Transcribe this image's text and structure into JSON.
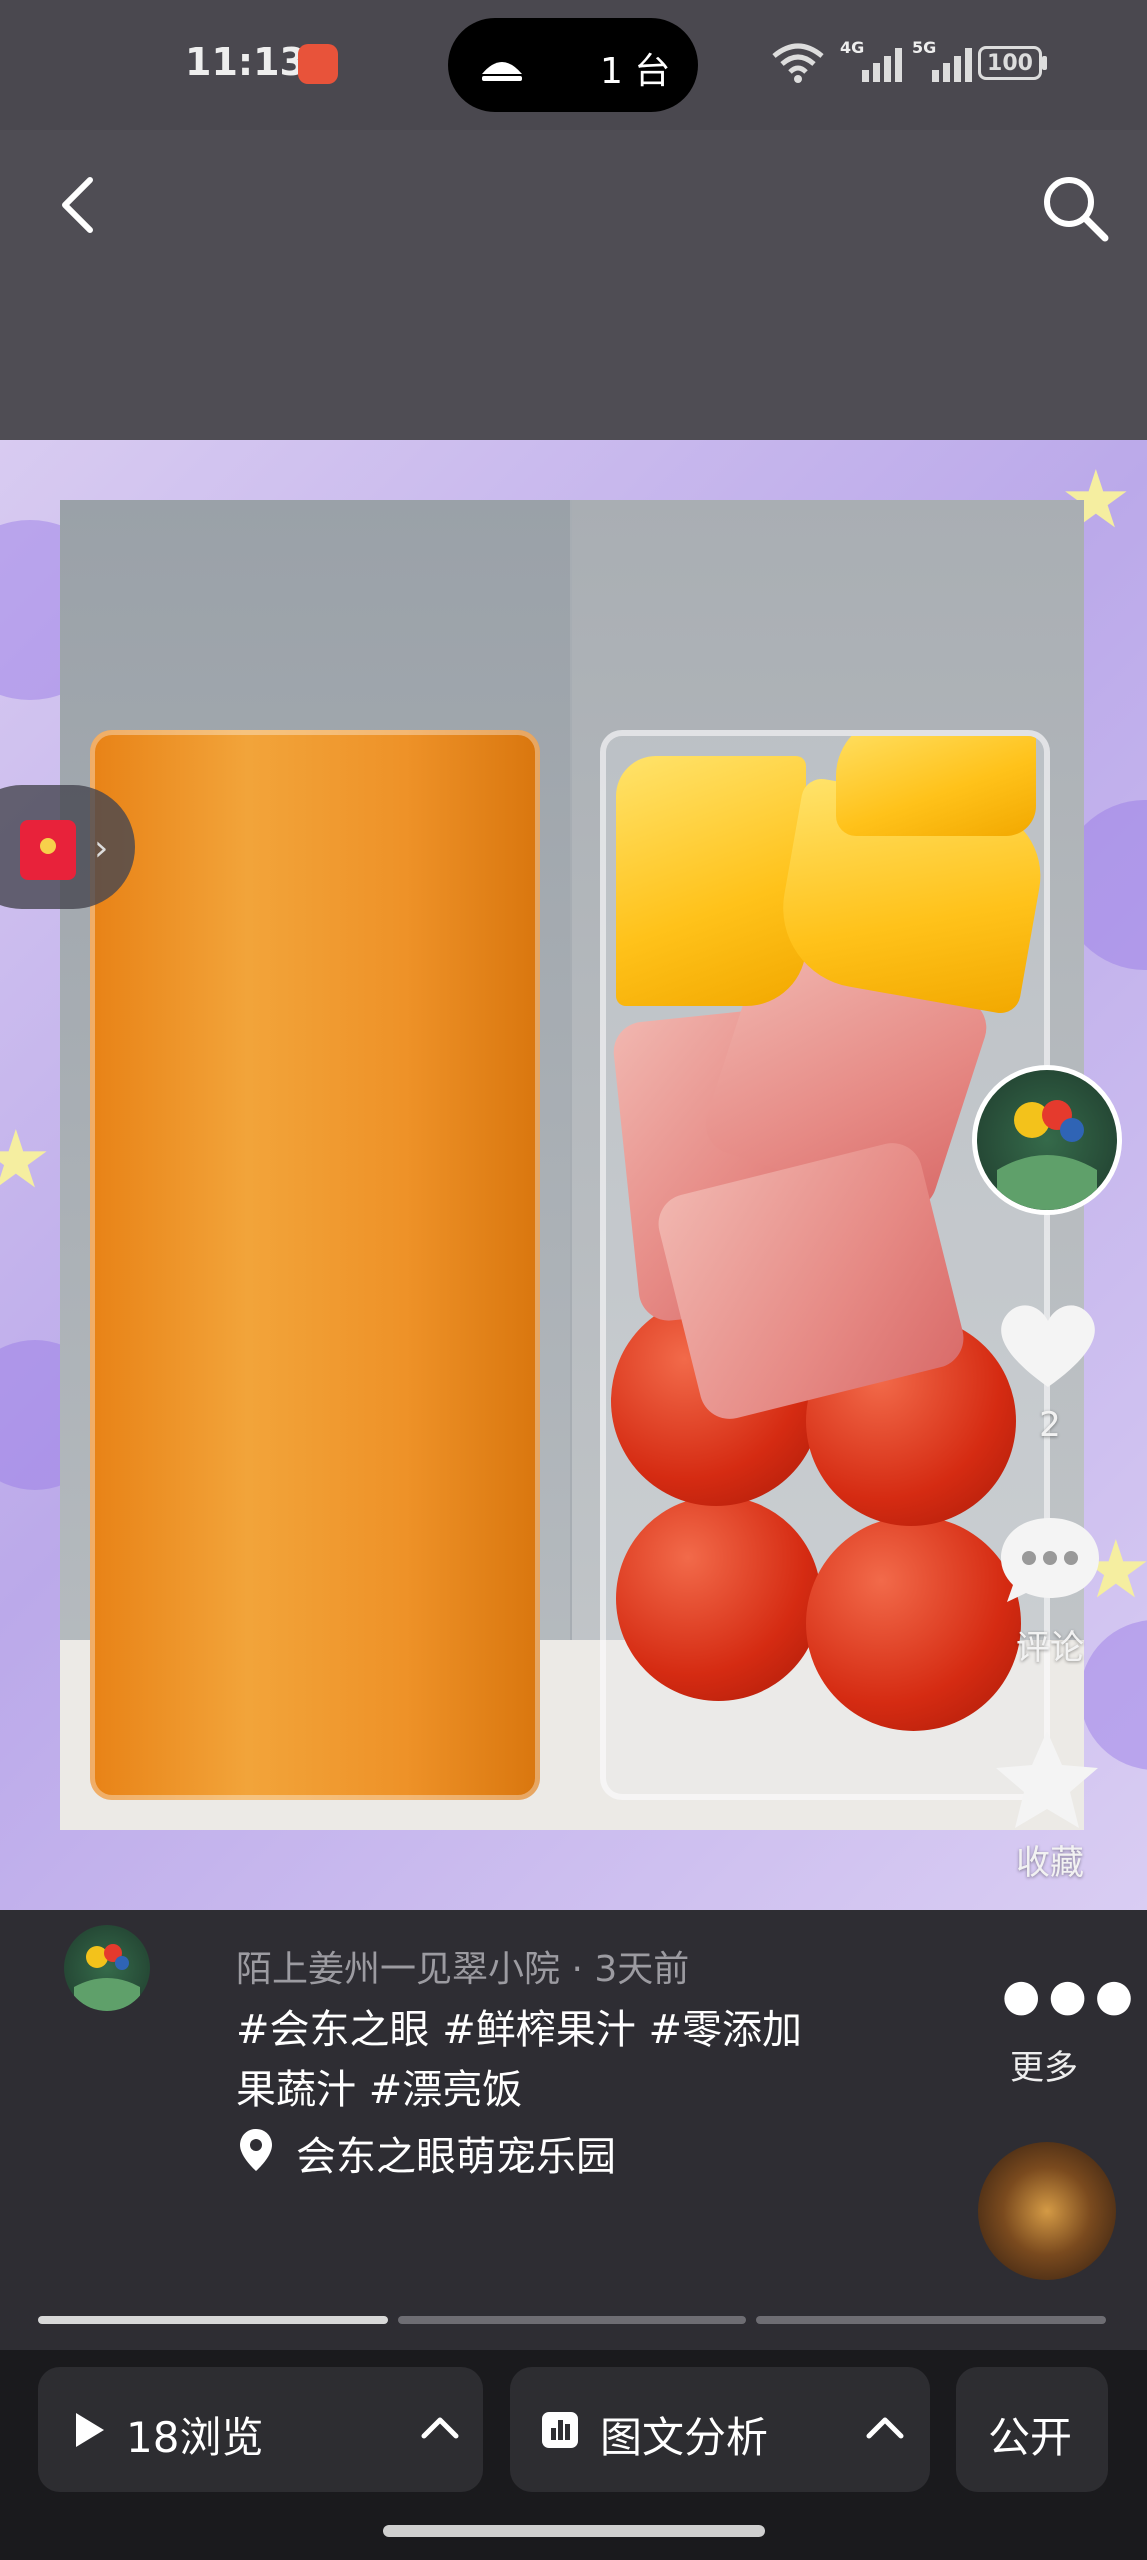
{
  "status_bar": {
    "time": "11:13",
    "island_text": "1 台",
    "net_4g": "4G",
    "net_5g": "5G",
    "battery": "100"
  },
  "rail": {
    "like_count": "2",
    "comment_label": "评论",
    "favorite_label": "收藏"
  },
  "post": {
    "author_line": "陌上姜州一见翠小院 · 3天前",
    "description": "#会东之眼 #鲜榨果汁 #零添加果蔬汁 #漂亮饭",
    "location": "会东之眼萌宠乐园",
    "more_label": "更多",
    "progress_active": 0
  },
  "bottom_bar": {
    "views_label": "18浏览",
    "analysis_label": "图文分析",
    "public_label": "公开"
  },
  "colors": {
    "accent_orange": "#f2a43a",
    "like_heart": "#f4f4f4",
    "redpacket": "#e8223a"
  },
  "icons": [
    "back-icon",
    "search-icon",
    "redpacket-icon",
    "heart-icon",
    "comment-icon",
    "star-icon",
    "location-icon",
    "play-icon",
    "chart-icon",
    "chevron-up-icon"
  ]
}
